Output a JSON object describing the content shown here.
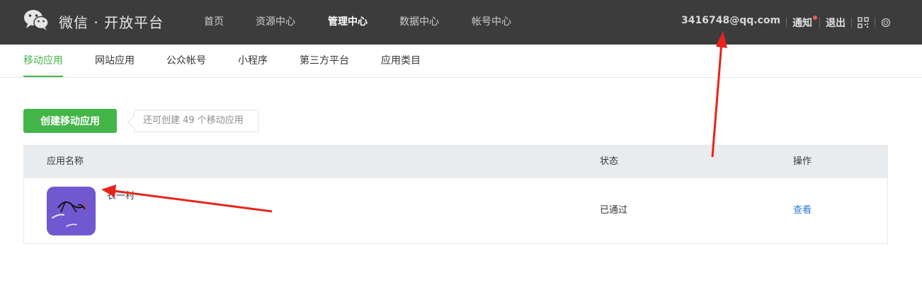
{
  "header": {
    "brand": "微信 · 开放平台",
    "nav": [
      "首页",
      "资源中心",
      "管理中心",
      "数据中心",
      "帐号中心"
    ],
    "active_nav": "管理中心",
    "user_email": "3416748@qq.com",
    "notify_label": "通知",
    "logout_label": "退出"
  },
  "subnav": {
    "items": [
      "移动应用",
      "网站应用",
      "公众帐号",
      "小程序",
      "第三方平台",
      "应用类目"
    ],
    "active": "移动应用"
  },
  "toolbar": {
    "create_label": "创建移动应用",
    "tip": "还可创建 49 个移动应用"
  },
  "table": {
    "columns": [
      "应用名称",
      "状态",
      "操作"
    ],
    "rows": [
      {
        "name": "衣一村",
        "status": "已通过",
        "action": "查看"
      }
    ]
  },
  "colors": {
    "accent": "#44b549",
    "topbar": "#3c3c3c",
    "link": "#2a7ad2",
    "annotation_arrow": "#e8231c",
    "app_icon_bg": "#6f58d0"
  }
}
